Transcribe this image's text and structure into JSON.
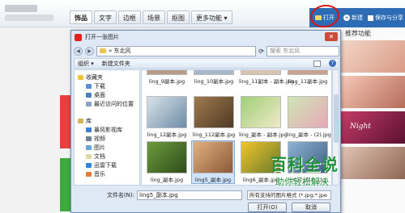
{
  "app": {
    "tabs": [
      "饰品",
      "文字",
      "边框",
      "场景",
      "抠图",
      "更多功能 ▾"
    ],
    "open_label": "打开",
    "new_label": "新建",
    "save_share_label": "保存与分享",
    "right_panel_title": "推荐功能",
    "night_text": "Night"
  },
  "dialog": {
    "title": "打开一张图片",
    "close_glyph": "✕",
    "address": "« 东北风",
    "search_placeholder": "搜索 东北风",
    "toolbar": {
      "organize": "组织 ▾",
      "new_folder": "新建文件夹"
    },
    "nav": {
      "favorites": "收藏夹",
      "downloads": "下载",
      "desktop": "桌面",
      "recent": "最近访问的位置",
      "libraries": "库",
      "storm": "暴风影视库",
      "videos": "视频",
      "pictures": "图片",
      "documents": "文档",
      "thunder": "迅雷下载",
      "music": "音乐"
    },
    "files": [
      "ling_9副本.jpg",
      "ling_10副本.jpg",
      "ling_11副本 - 副本.jpg",
      "ling_11副本.jpg",
      "ling_12副本.jpg",
      "ling_112副本.jpg",
      "ling_副本 - 副本.jpg",
      "ling_副本 - (2).jpg",
      "ling_副本.jpg",
      "ling5_副本.jpg",
      "ling6_副本.jpg",
      "ling7_副本.jpg"
    ],
    "filename_label": "文件名(N):",
    "filename_value": "ling5_副本.jpg",
    "filter_value": "所有支持的图片格式 (*.jpg;*.jpe",
    "open_button": "打开(O)",
    "cancel_button": "取消"
  },
  "watermark": {
    "title": "百科全说",
    "subtitle": "助你轻松解决"
  },
  "colors": {
    "accent": "#2b6cb4",
    "close": "#c94b3a",
    "watermark": "#1f8f3a",
    "highlight": "#d11111"
  }
}
